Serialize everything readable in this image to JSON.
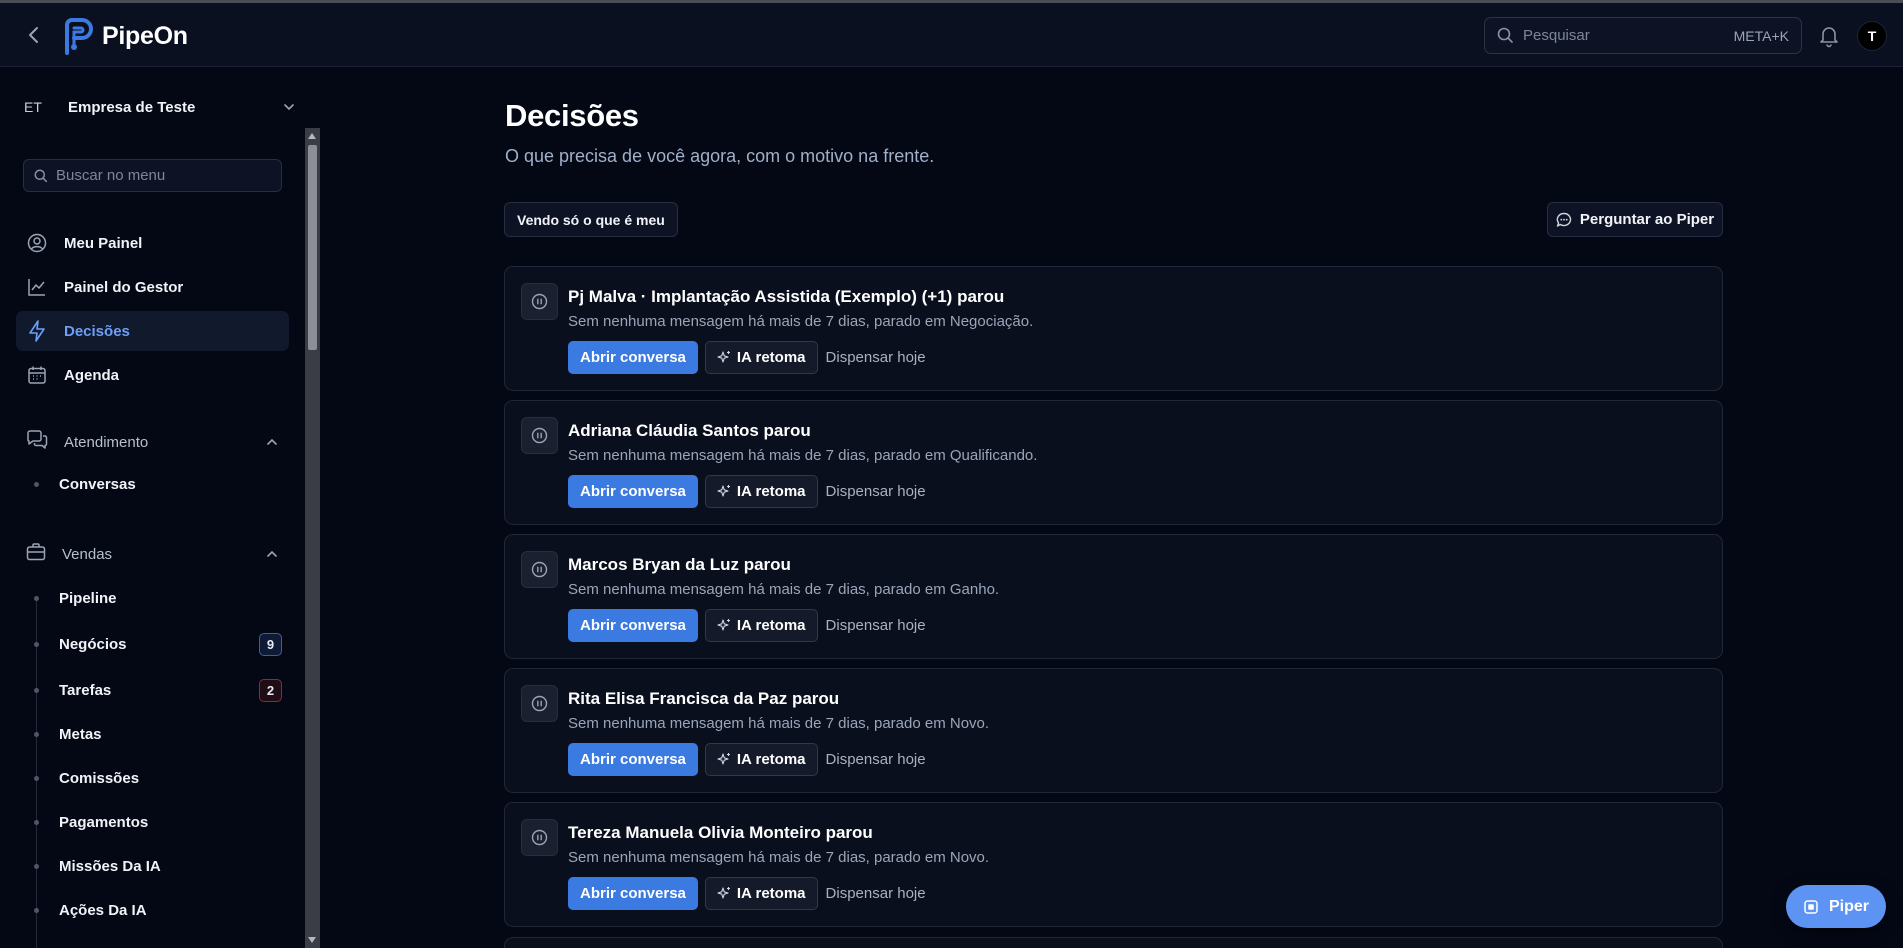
{
  "app": {
    "name": "PipeOn"
  },
  "header": {
    "search_placeholder": "Pesquisar",
    "search_shortcut": "META+K",
    "avatar_initial": "T"
  },
  "sidebar": {
    "company_abbr": "ET",
    "company_name": "Empresa de Teste",
    "menu_search_placeholder": "Buscar no menu",
    "items": [
      {
        "label": "Meu Painel",
        "icon": "user-circle-icon"
      },
      {
        "label": "Painel do Gestor",
        "icon": "chart-line-icon"
      },
      {
        "label": "Decisões",
        "icon": "lightning-icon",
        "active": true
      },
      {
        "label": "Agenda",
        "icon": "calendar-icon"
      }
    ],
    "sections": [
      {
        "label": "Atendimento",
        "icon": "chat-bubbles-icon",
        "expanded": true,
        "items": [
          {
            "label": "Conversas"
          }
        ]
      },
      {
        "label": "Vendas",
        "icon": "briefcase-icon",
        "expanded": true,
        "items": [
          {
            "label": "Pipeline"
          },
          {
            "label": "Negócios",
            "badge": "9"
          },
          {
            "label": "Tarefas",
            "badge": "2"
          },
          {
            "label": "Metas"
          },
          {
            "label": "Comissões"
          },
          {
            "label": "Pagamentos"
          },
          {
            "label": "Missões Da IA"
          },
          {
            "label": "Ações Da IA"
          }
        ]
      }
    ]
  },
  "main": {
    "title": "Decisões",
    "subtitle": "O que precisa de você agora, com o motivo na frente.",
    "filter_label": "Vendo só o que é meu",
    "ask_label": "Perguntar ao Piper",
    "actions": {
      "open": "Abrir conversa",
      "ai": "IA retoma",
      "dismiss": "Dispensar hoje"
    },
    "decisions": [
      {
        "title": "Pj Malva · Implantação Assistida (Exemplo) (+1) parou",
        "description": "Sem nenhuma mensagem há mais de 7 dias, parado em Negociação."
      },
      {
        "title": "Adriana Cláudia Santos parou",
        "description": "Sem nenhuma mensagem há mais de 7 dias, parado em Qualificando."
      },
      {
        "title": "Marcos Bryan da Luz parou",
        "description": "Sem nenhuma mensagem há mais de 7 dias, parado em Ganho."
      },
      {
        "title": "Rita Elisa Francisca da Paz parou",
        "description": "Sem nenhuma mensagem há mais de 7 dias, parado em Novo."
      },
      {
        "title": "Tereza Manuela Olivia Monteiro parou",
        "description": "Sem nenhuma mensagem há mais de 7 dias, parado em Novo."
      }
    ]
  },
  "fab": {
    "label": "Piper"
  },
  "colors": {
    "background": "#040815",
    "accent": "#3b7ae0",
    "active_text": "#6d9ff7",
    "fab": "#5d93f2"
  }
}
